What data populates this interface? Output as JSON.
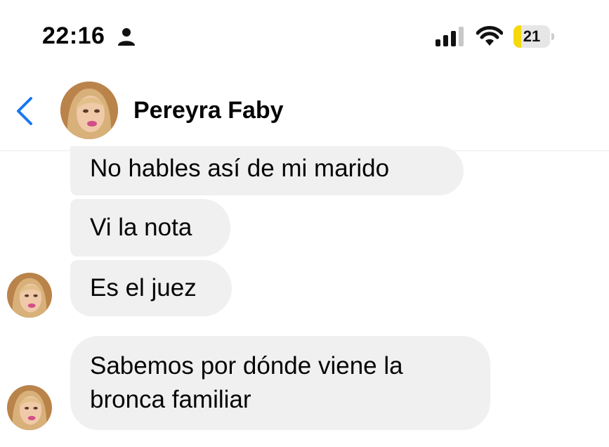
{
  "status_bar": {
    "time": "22:16",
    "battery_level": "21",
    "battery_fraction": 0.21,
    "icons": [
      "person-icon",
      "signal-icon",
      "wifi-icon",
      "battery-icon"
    ]
  },
  "header": {
    "contact_name": "Pereyra Faby",
    "back_icon": "chevron-left-icon",
    "accent_color": "#1877f2"
  },
  "messages": [
    {
      "text": "No hables así de mi marido"
    },
    {
      "text": "Vi la nota"
    },
    {
      "text": "Es el juez"
    },
    {
      "text": "Sabemos por dónde viene la bronca familiar"
    }
  ],
  "colors": {
    "bubble": "#f0f0f0",
    "battery_fill": "#f5d90a"
  }
}
